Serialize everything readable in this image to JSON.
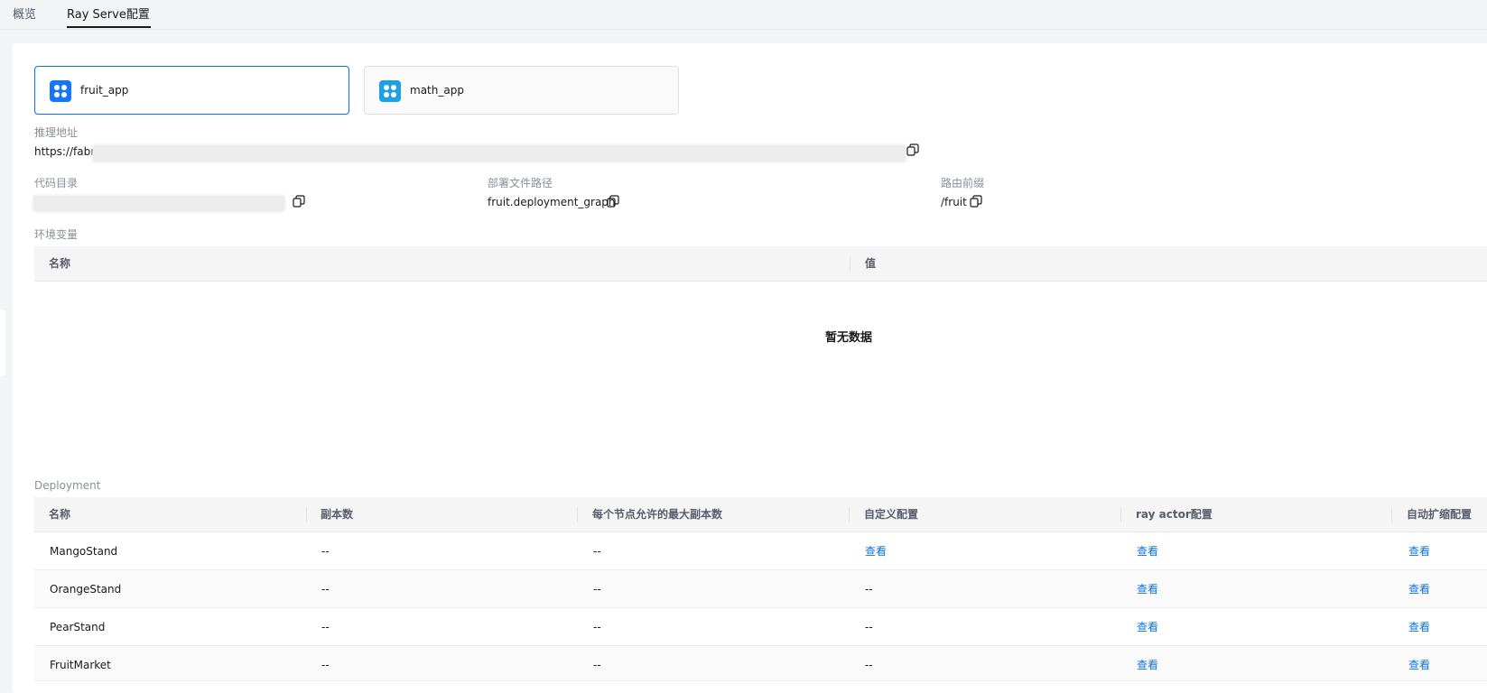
{
  "tabs": [
    {
      "label": "概览",
      "active": false
    },
    {
      "label": "Ray Serve配置",
      "active": true
    }
  ],
  "apps": [
    {
      "name": "fruit_app",
      "selected": true,
      "icon": "app-grid-icon"
    },
    {
      "name": "math_app",
      "selected": false,
      "icon": "app-grid-icon"
    }
  ],
  "inference": {
    "label": "推理地址",
    "value": "https://fabric"
  },
  "code_dir": {
    "label": "代码目录",
    "value": ""
  },
  "deploy_path": {
    "label": "部署文件路径",
    "value": "fruit.deployment_graph"
  },
  "route_prefix": {
    "label": "路由前缀",
    "value": "/fruit"
  },
  "env": {
    "label": "环境变量",
    "columns": [
      "名称",
      "值"
    ],
    "empty_text": "暂无数据"
  },
  "deployment": {
    "label": "Deployment",
    "columns": [
      "名称",
      "副本数",
      "每个节点允许的最大副本数",
      "自定义配置",
      "ray actor配置",
      "自动扩缩配置"
    ],
    "rows": [
      {
        "name": "MangoStand",
        "replicas": "--",
        "max_per_node": "--",
        "custom": "查看",
        "actor": "查看",
        "autoscale": "查看"
      },
      {
        "name": "OrangeStand",
        "replicas": "--",
        "max_per_node": "--",
        "custom": "--",
        "actor": "查看",
        "autoscale": "查看"
      },
      {
        "name": "PearStand",
        "replicas": "--",
        "max_per_node": "--",
        "custom": "--",
        "actor": "查看",
        "autoscale": "查看"
      },
      {
        "name": "FruitMarket",
        "replicas": "--",
        "max_per_node": "--",
        "custom": "--",
        "actor": "查看",
        "autoscale": "查看"
      }
    ]
  },
  "colors": {
    "accent": "#0a72e8",
    "app_icon_primary": "#1476ff",
    "app_icon_secondary": "#1ea0e6"
  }
}
